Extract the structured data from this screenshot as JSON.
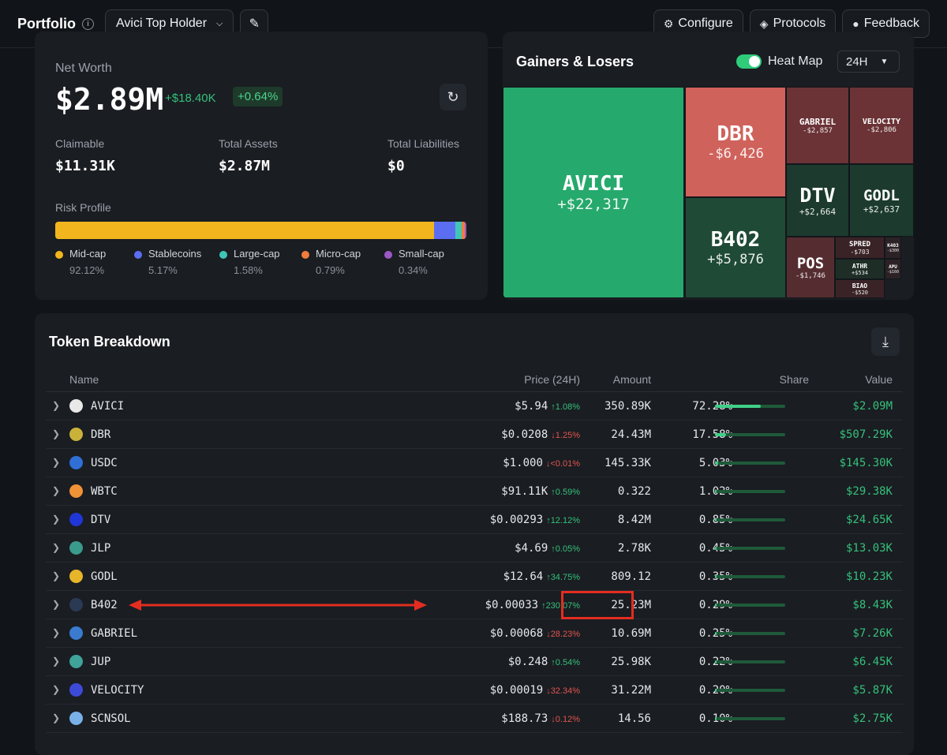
{
  "header": {
    "title": "Portfolio",
    "holder_select": "Avici Top Holder",
    "configure": "Configure",
    "protocols": "Protocols",
    "feedback": "Feedback"
  },
  "networth": {
    "label": "Net Worth",
    "value": "$2.89M",
    "change": "+$18.40K",
    "change_pct": "+0.64%",
    "stats": [
      {
        "label": "Claimable",
        "value": "$11.31K"
      },
      {
        "label": "Total Assets",
        "value": "$2.87M"
      },
      {
        "label": "Total Liabilities",
        "value": "$0"
      }
    ],
    "risk_label": "Risk Profile",
    "risk": [
      {
        "name": "Mid-cap",
        "pct": "92.12%",
        "share": 92.12,
        "color": "#f2b51d"
      },
      {
        "name": "Stablecoins",
        "pct": "5.17%",
        "share": 5.17,
        "color": "#5b6ef2"
      },
      {
        "name": "Large-cap",
        "pct": "1.58%",
        "share": 1.58,
        "color": "#3fc6b8"
      },
      {
        "name": "Micro-cap",
        "pct": "0.79%",
        "share": 0.79,
        "color": "#f07d3b"
      },
      {
        "name": "Small-cap",
        "pct": "0.34%",
        "share": 0.34,
        "color": "#9b59c6"
      }
    ]
  },
  "gainers_losers": {
    "title": "Gainers & Losers",
    "heat_map_label": "Heat Map",
    "period": "24H",
    "tiles": [
      {
        "name": "AVICI",
        "value": "+$22,317",
        "color": "#26a96c"
      },
      {
        "name": "DBR",
        "value": "-$6,426",
        "color": "#d0625c"
      },
      {
        "name": "B402",
        "value": "+$5,876",
        "color": "#1f4a36"
      },
      {
        "name": "GABRIEL",
        "value": "-$2,857",
        "color": "#6b3336"
      },
      {
        "name": "VELOCITY",
        "value": "-$2,806",
        "color": "#6b3336"
      },
      {
        "name": "DTV",
        "value": "+$2,664",
        "color": "#1c3a2e"
      },
      {
        "name": "GODL",
        "value": "+$2,637",
        "color": "#1c3a2e"
      },
      {
        "name": "POS",
        "value": "-$1,746",
        "color": "#552d31"
      },
      {
        "name": "SPRED",
        "value": "-$703",
        "color": "#3a2327"
      },
      {
        "name": "ATHR",
        "value": "+$534",
        "color": "#1e2e27"
      },
      {
        "name": "BIAO",
        "value": "-$520",
        "color": "#3a2327"
      },
      {
        "name": "K403",
        "value": "-$300",
        "color": "#2c2226"
      },
      {
        "name": "APU",
        "value": "-$160",
        "color": "#2c2226"
      }
    ]
  },
  "table": {
    "title": "Token Breakdown",
    "headers": {
      "name": "Name",
      "price": "Price (24H)",
      "amount": "Amount",
      "share": "Share",
      "value": "Value"
    },
    "rows": [
      {
        "name": "AVICI",
        "price": "$5.94",
        "change": "↑1.08%",
        "dir": "up",
        "amount": "350.89K",
        "share": "72.28%",
        "share_num": 72.28,
        "value": "$2.09M",
        "icon_color": "#e8e8e8"
      },
      {
        "name": "DBR",
        "price": "$0.0208",
        "change": "↓1.25%",
        "dir": "down",
        "amount": "24.43M",
        "share": "17.58%",
        "share_num": 17.58,
        "value": "$507.29K",
        "icon_color": "#c9b13a"
      },
      {
        "name": "USDC",
        "price": "$1.000",
        "change": "↓<0.01%",
        "dir": "down",
        "amount": "145.33K",
        "share": "5.03%",
        "share_num": 5.03,
        "value": "$145.30K",
        "icon_color": "#2f6fd6"
      },
      {
        "name": "WBTC",
        "price": "$91.11K",
        "change": "↑0.59%",
        "dir": "up",
        "amount": "0.322",
        "share": "1.02%",
        "share_num": 1.02,
        "value": "$29.38K",
        "icon_color": "#f09236"
      },
      {
        "name": "DTV",
        "price": "$0.00293",
        "change": "↑12.12%",
        "dir": "up",
        "amount": "8.42M",
        "share": "0.85%",
        "share_num": 0.85,
        "value": "$24.65K",
        "icon_color": "#2036d6"
      },
      {
        "name": "JLP",
        "price": "$4.69",
        "change": "↑0.05%",
        "dir": "up",
        "amount": "2.78K",
        "share": "0.45%",
        "share_num": 0.45,
        "value": "$13.03K",
        "icon_color": "#3a9a8c"
      },
      {
        "name": "GODL",
        "price": "$12.64",
        "change": "↑34.75%",
        "dir": "up",
        "amount": "809.12",
        "share": "0.35%",
        "share_num": 0.35,
        "value": "$10.23K",
        "icon_color": "#e6b52a"
      },
      {
        "name": "B402",
        "price": "$0.00033",
        "change": "↑230.07%",
        "dir": "up",
        "amount": "25.23M",
        "share": "0.29%",
        "share_num": 0.29,
        "value": "$8.43K",
        "icon_color": "#2a3a55"
      },
      {
        "name": "GABRIEL",
        "price": "$0.00068",
        "change": "↓28.23%",
        "dir": "down",
        "amount": "10.69M",
        "share": "0.25%",
        "share_num": 0.25,
        "value": "$7.26K",
        "icon_color": "#3a7bd0"
      },
      {
        "name": "JUP",
        "price": "$0.248",
        "change": "↑0.54%",
        "dir": "up",
        "amount": "25.98K",
        "share": "0.22%",
        "share_num": 0.22,
        "value": "$6.45K",
        "icon_color": "#3fa39a"
      },
      {
        "name": "VELOCITY",
        "price": "$0.00019",
        "change": "↓32.34%",
        "dir": "down",
        "amount": "31.22M",
        "share": "0.20%",
        "share_num": 0.2,
        "value": "$5.87K",
        "icon_color": "#3d4ad8"
      },
      {
        "name": "SCNSOL",
        "price": "$188.73",
        "change": "↓0.12%",
        "dir": "down",
        "amount": "14.56",
        "share": "0.10%",
        "share_num": 0.1,
        "value": "$2.75K",
        "icon_color": "#7ab0e8"
      }
    ]
  }
}
